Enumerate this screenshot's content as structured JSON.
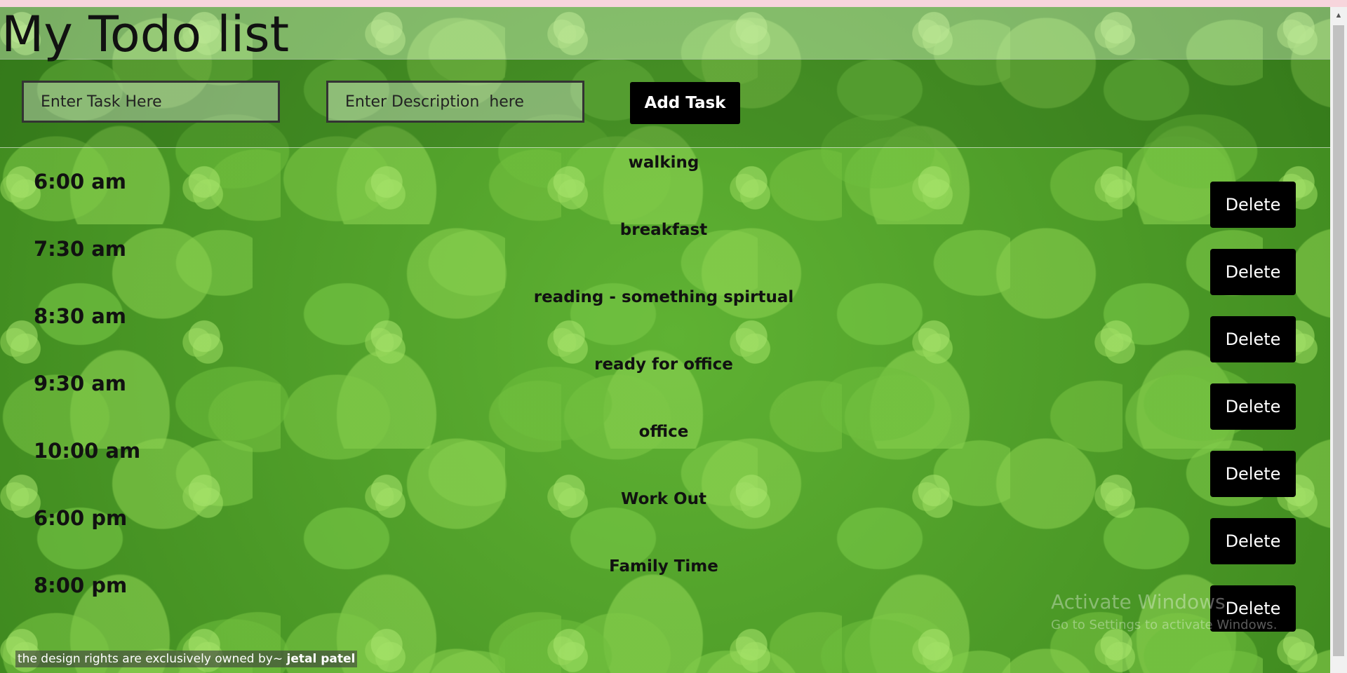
{
  "header": {
    "title": "My Todo list"
  },
  "form": {
    "task_placeholder": "Enter Task Here",
    "description_placeholder": "Enter Description  here",
    "add_label": "Add Task"
  },
  "tasks": [
    {
      "time": "6:00 am",
      "description": "walking",
      "delete_label": "Delete"
    },
    {
      "time": "7:30 am",
      "description": "breakfast",
      "delete_label": "Delete"
    },
    {
      "time": "8:30 am",
      "description": "reading - something spirtual",
      "delete_label": "Delete"
    },
    {
      "time": "9:30 am",
      "description": "ready for office",
      "delete_label": "Delete"
    },
    {
      "time": "10:00 am",
      "description": "office",
      "delete_label": "Delete"
    },
    {
      "time": "6:00 pm",
      "description": "Work Out",
      "delete_label": "Delete"
    },
    {
      "time": "8:00 pm",
      "description": "Family Time",
      "delete_label": "Delete"
    }
  ],
  "watermark": {
    "line1": "Activate Windows",
    "line2": "Go to Settings to activate Windows."
  },
  "footer": {
    "text": "the design rights are exclusively owned by~ ",
    "owner": "jetal patel"
  },
  "colors": {
    "button_bg": "#000000",
    "button_text": "#ffffff",
    "top_strip": "#f7d5dc"
  }
}
